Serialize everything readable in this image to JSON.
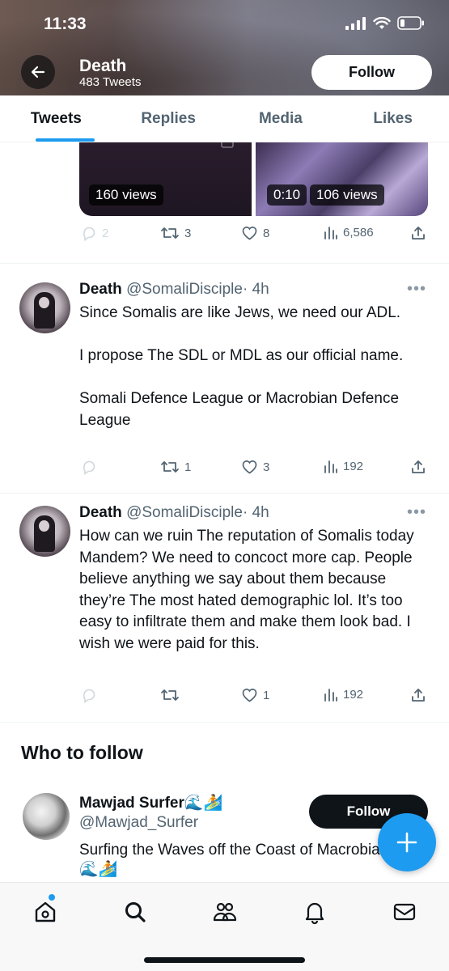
{
  "status_bar": {
    "time": "11:33"
  },
  "header": {
    "name": "Death",
    "tweet_count": "483 Tweets",
    "follow_label": "Follow"
  },
  "tabs": [
    {
      "label": "Tweets",
      "active": true
    },
    {
      "label": "Replies",
      "active": false
    },
    {
      "label": "Media",
      "active": false
    },
    {
      "label": "Likes",
      "active": false
    }
  ],
  "media_tweet": {
    "left_views": "160 views",
    "right_duration": "0:10",
    "right_views": "106 views",
    "actions": {
      "replies": "2",
      "retweets": "3",
      "likes": "8",
      "views": "6,586"
    }
  },
  "tweets": [
    {
      "name": "Death",
      "handle": "@SomaliDisciple",
      "time": "· 4h",
      "body": "Since Somalis are like Jews, we need our ADL.\n\nI propose The SDL or MDL as our official name.\n\nSomali Defence League or Macrobian Defence League",
      "actions": {
        "replies": "",
        "retweets": "1",
        "likes": "3",
        "views": "192"
      }
    },
    {
      "name": "Death",
      "handle": "@SomaliDisciple",
      "time": "· 4h",
      "body": "How can we ruin The reputation of Somalis today Mandem? We need to concoct more cap. People believe anything we say about them because they’re The most hated demographic lol. It’s too easy to infiltrate them and make them look bad. I wish we were paid for this.",
      "actions": {
        "replies": "",
        "retweets": "",
        "likes": "1",
        "views": "192"
      }
    }
  ],
  "who_to_follow": {
    "title": "Who to follow",
    "name": "Mawjad Surfer🌊🏄",
    "handle": "@Mawjad_Surfer",
    "bio": "Surfing the Waves off the Coast of Macrobia",
    "bio_line2": "🌊🏄",
    "follow_label": "Follow"
  },
  "colors": {
    "accent": "#1d9bf0",
    "text": "#0f1419",
    "muted": "#536471"
  }
}
